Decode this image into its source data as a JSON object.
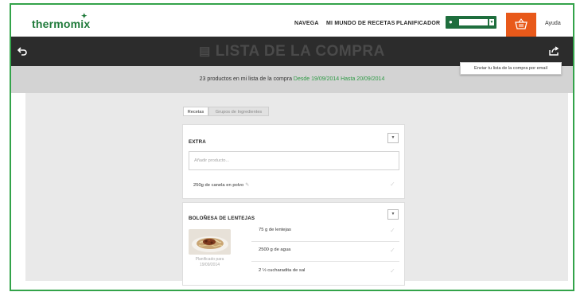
{
  "header": {
    "logo": "thermomix",
    "nav": [
      "NAVEGA",
      "MI MUNDO DE RECETAS",
      "PLANIFICADOR"
    ],
    "help": "Ayuda",
    "cart_icon": "shopping-basket-icon",
    "user_icon": "user-icon"
  },
  "titlebar": {
    "title": "LISTA DE LA COMPRA",
    "back_icon": "back-arrow-icon",
    "share_icon": "share-icon",
    "title_icon": "list-icon"
  },
  "summary": {
    "text": "23 productos en mi lista de la compra",
    "range": "Desde 19/09/2014 Hasta 20/09/2014"
  },
  "tooltip": "Enviar tu lista de la compra por email",
  "tabs": [
    "Recetas",
    "Grupos de Ingredientes"
  ],
  "extra_card": {
    "title": "EXTRA",
    "add_placeholder": "Añadir producto...",
    "item": "250g de canela en polvo"
  },
  "recipe_card": {
    "title": "BOLOÑESA DE LENTEJAS",
    "planned_line1": "Planificado para",
    "planned_line2": "19/09/2014",
    "items": [
      "75 g de lentejas",
      "2500 g de agua",
      "2 ½ cucharadita de sal"
    ]
  },
  "colors": {
    "brand_green": "#1f7a3a",
    "accent_green": "#2e9a45",
    "cart_orange": "#e8591a",
    "titlebar_dark": "#2c2c2c",
    "frame_green": "#33a34a"
  }
}
